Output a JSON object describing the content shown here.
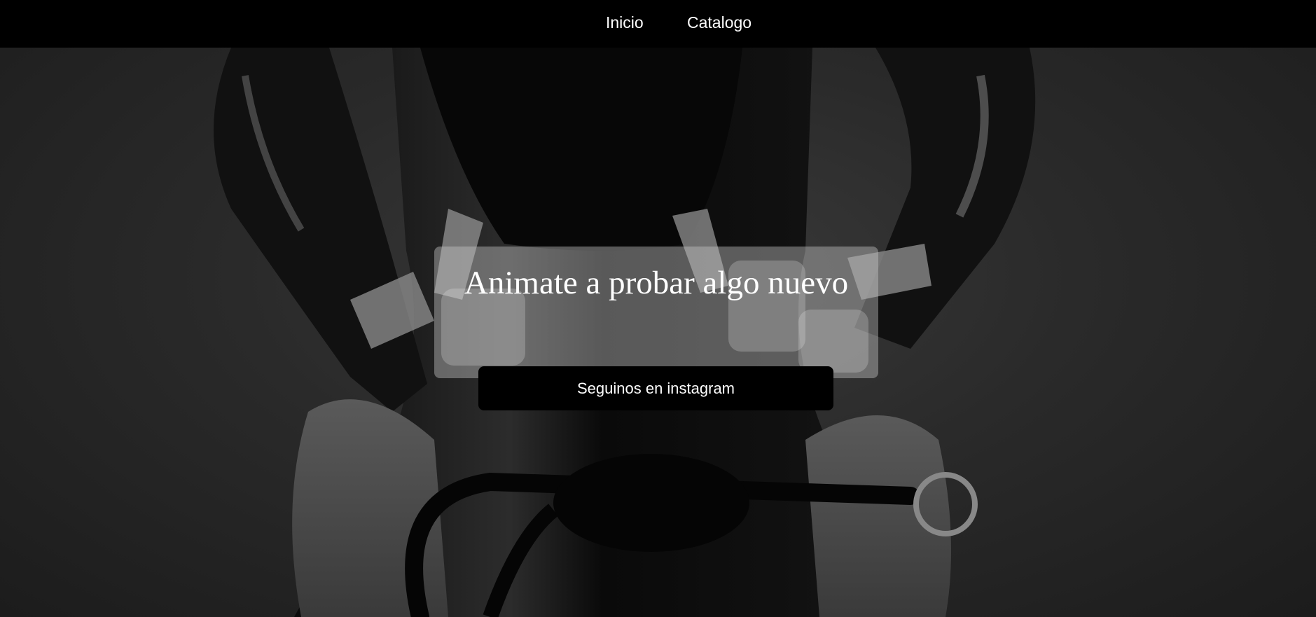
{
  "nav": {
    "items": [
      {
        "label": "Inicio"
      },
      {
        "label": "Catalogo"
      }
    ]
  },
  "hero": {
    "image": "black-and-white photo of person in latex outfit holding a whip",
    "headline": "Animate a probar algo nuevo",
    "button_label": "Seguinos en instagram"
  },
  "colors": {
    "nav_bg": "#000000",
    "button_bg": "#000000",
    "text": "#ffffff"
  }
}
